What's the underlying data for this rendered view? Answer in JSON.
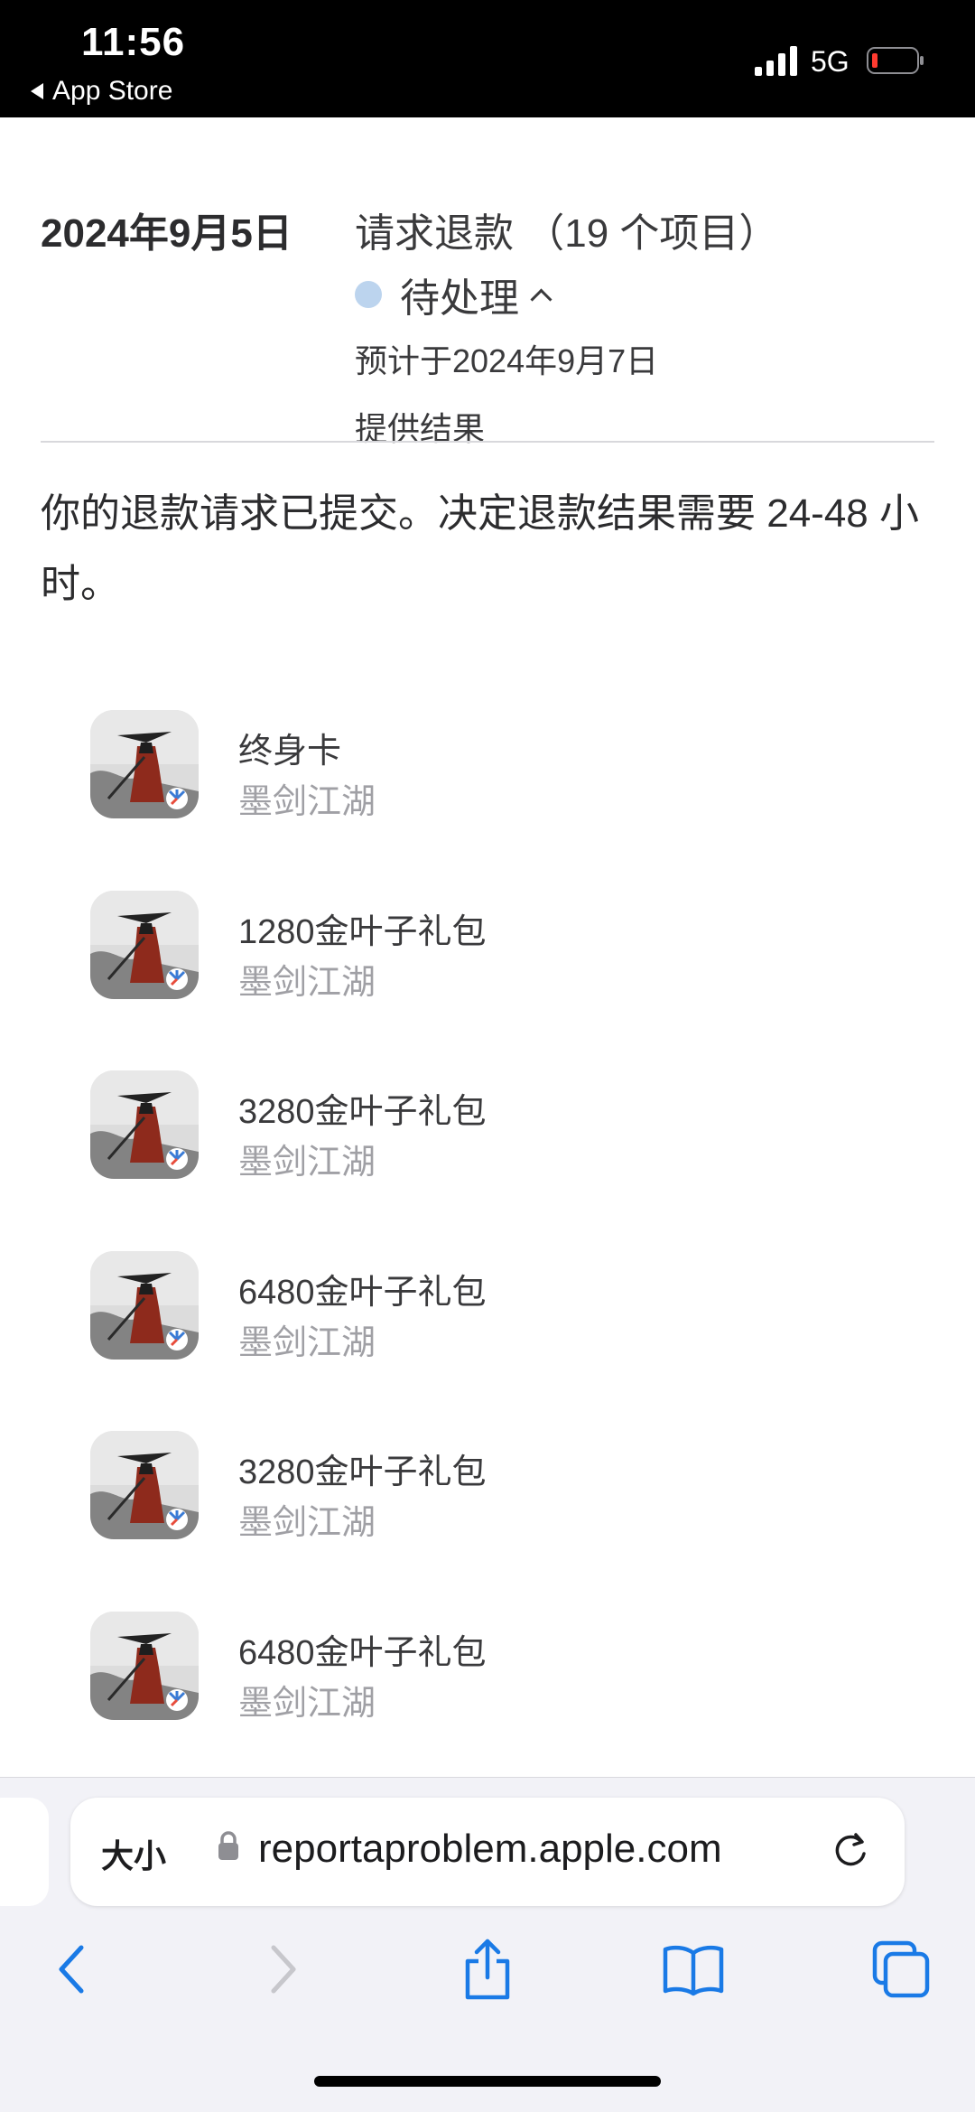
{
  "status_bar": {
    "time": "11:56",
    "back_app": "App Store",
    "network": "5G"
  },
  "header": {
    "date": "2024年9月5日",
    "request_title": "请求退款 （19 个项目）",
    "status": "待处理",
    "eta_line1": "预计于2024年9月7日",
    "eta_line2": "提供结果"
  },
  "message": "你的退款请求已提交。决定退款结果需要 24-48 小时。",
  "items": [
    {
      "name": "终身卡",
      "app": "墨剑江湖"
    },
    {
      "name": "1280金叶子礼包",
      "app": "墨剑江湖"
    },
    {
      "name": "3280金叶子礼包",
      "app": "墨剑江湖"
    },
    {
      "name": "6480金叶子礼包",
      "app": "墨剑江湖"
    },
    {
      "name": "3280金叶子礼包",
      "app": "墨剑江湖"
    },
    {
      "name": "6480金叶子礼包",
      "app": "墨剑江湖"
    }
  ],
  "browser": {
    "text_size_label": "大小",
    "url": "reportaproblem.apple.com"
  },
  "icons": {
    "back": "chevron-left-icon",
    "forward": "chevron-right-icon",
    "share": "share-icon",
    "bookmarks": "book-icon",
    "tabs": "tabs-icon",
    "reload": "reload-icon",
    "lock": "lock-icon"
  },
  "colors": {
    "accent": "#1a7ae6",
    "status_dot": "#bcd4ee",
    "secondary_text": "#a0a0a5"
  }
}
